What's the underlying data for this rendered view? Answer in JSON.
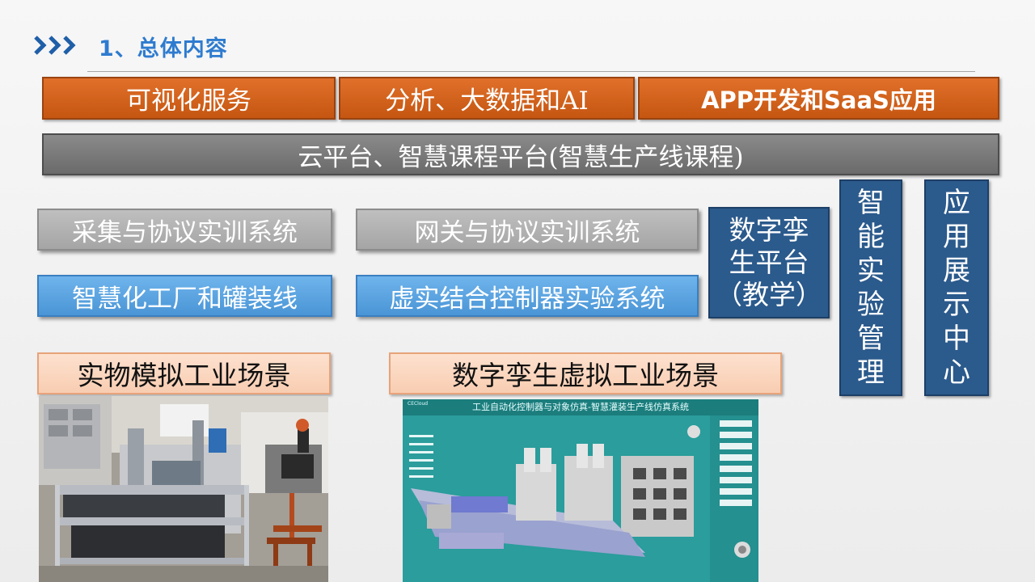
{
  "header": {
    "title": "1、总体内容",
    "chevron_icon": "triple-chevron-right-icon",
    "accent_color": "#2e7bcf"
  },
  "top_row": [
    {
      "label": "可视化服务"
    },
    {
      "label": "分析、大数据和AI"
    },
    {
      "label": "APP开发和SaaS应用"
    }
  ],
  "cloud_platform": {
    "label": "云平台、智慧课程平台(智慧生产线课程)"
  },
  "training_systems": {
    "acquisition": "采集与协议实训系统",
    "gateway": "网关与协议实训系统",
    "factory": "智慧化工厂和罐装线",
    "controller": "虚实结合控制器实验系统"
  },
  "digital_twin": {
    "lines": [
      "数字孪",
      "生平台",
      "（教学）"
    ]
  },
  "lab_management": {
    "chars": [
      "智",
      "能",
      "实",
      "验",
      "管",
      "理"
    ]
  },
  "showcase_center": {
    "chars": [
      "应",
      "用",
      "展",
      "示",
      "中",
      "心"
    ]
  },
  "scenes": {
    "physical": {
      "label": "实物模拟工业场景"
    },
    "virtual": {
      "label": "数字孪生虚拟工业场景"
    }
  },
  "simulation": {
    "header": "工业自动化控制器与对象仿真-智慧灌装生产线仿真系统",
    "logo": "CECloud"
  },
  "colors": {
    "orange": "#c55a11",
    "dark_gray": "#7f7f7f",
    "light_gray": "#afafaf",
    "blue": "#5b9bd5",
    "navy": "#2b5a8c",
    "peach": "#fbd5bd"
  }
}
